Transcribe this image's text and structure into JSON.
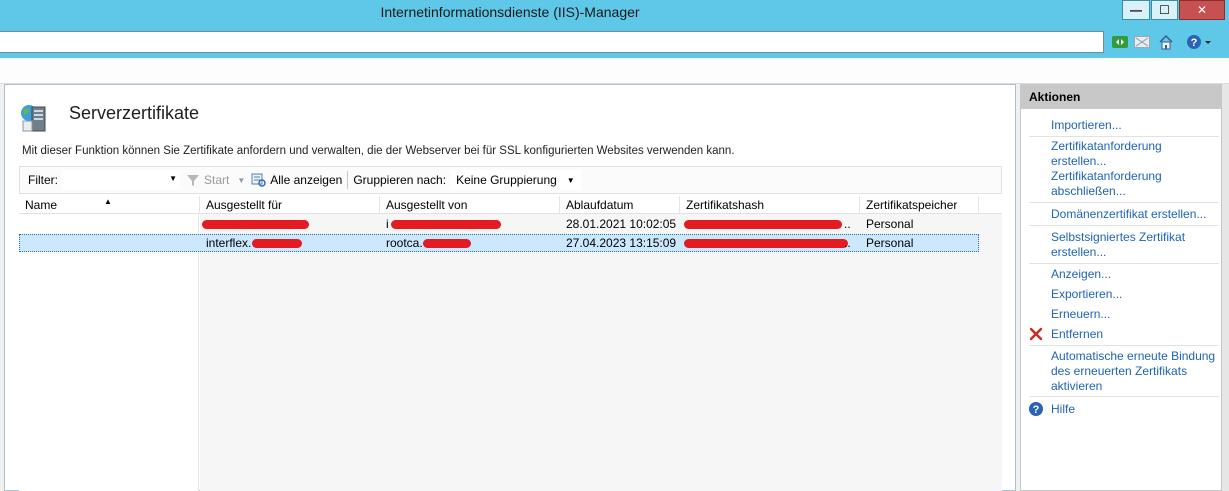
{
  "window": {
    "title": "Internetinformationsdienste (IIS)-Manager",
    "buttons": [
      "—",
      "☐",
      "✕"
    ]
  },
  "navbar": {
    "icons": [
      "refresh-icon",
      "stop-icon",
      "home-icon",
      "help-icon"
    ]
  },
  "page": {
    "title": "Serverzertifikate",
    "description": "Mit dieser Funktion können Sie Zertifikate anfordern und verwalten, die der Webserver bei für SSL konfigurierten Websites verwenden kann."
  },
  "filterbar": {
    "filter_label": "Filter:",
    "start_label": "Start",
    "show_all_label": "Alle anzeigen",
    "group_label": "Gruppieren nach:",
    "group_value": "Keine Gruppierung"
  },
  "grid": {
    "columns": [
      "Name",
      "Ausgestellt für",
      "Ausgestellt von",
      "Ablaufdatum",
      "Zertifikatshash",
      "Zertifikatspeicher"
    ],
    "rows": [
      {
        "name": "",
        "issued_to": "",
        "issued_by": "i",
        "expires": "28.01.2021 10:02:05",
        "hash": "",
        "hash_ellipsis": "..",
        "store": "Personal"
      },
      {
        "name": "",
        "issued_to": "interflex.",
        "issued_by": "rootca.",
        "expires": "27.04.2023 13:15:09",
        "hash": "",
        "hash_ellipsis": "..",
        "store": "Personal"
      }
    ]
  },
  "actions": {
    "header": "Aktionen",
    "items": [
      "Importieren...",
      "Zertifikatanforderung erstellen...",
      "Zertifikatanforderung abschließen...",
      "Domänenzertifikat erstellen...",
      "Selbstsigniertes Zertifikat erstellen...",
      "Anzeigen...",
      "Exportieren...",
      "Erneuern...",
      "Entfernen",
      "Automatische erneute Bindung des erneuerten Zertifikats aktivieren",
      "Hilfe"
    ]
  },
  "colors": {
    "titlebar": "#5fc8e8",
    "link": "#1e63b5",
    "selection": "#cce8ff",
    "redaction": "#e31b23"
  }
}
